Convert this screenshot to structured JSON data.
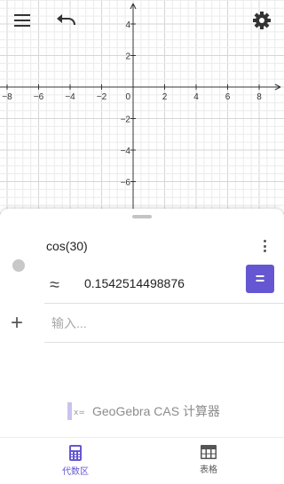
{
  "graph": {
    "x_range": [
      -9,
      9
    ],
    "y_range": [
      -7,
      7
    ],
    "x_tick_labels": [
      {
        "value": -8,
        "label": "−8"
      },
      {
        "value": -6,
        "label": "−6"
      },
      {
        "value": -4,
        "label": "−4"
      },
      {
        "value": -2,
        "label": "−2"
      },
      {
        "value": 2,
        "label": "2"
      },
      {
        "value": 4,
        "label": "4"
      },
      {
        "value": 6,
        "label": "6"
      },
      {
        "value": 8,
        "label": "8"
      }
    ],
    "y_tick_labels": [
      {
        "value": 4,
        "label": "4"
      },
      {
        "value": 2,
        "label": "2"
      },
      {
        "value": -2,
        "label": "−2"
      },
      {
        "value": -4,
        "label": "−4"
      },
      {
        "value": -6,
        "label": "−6"
      }
    ],
    "origin_label": "0",
    "grid": true
  },
  "toolbar": {
    "menu_icon": "menu-icon",
    "undo_icon": "undo-icon",
    "settings_icon": "gear-icon"
  },
  "algebra": {
    "expression": "cos(30)",
    "approx_symbol": "≈",
    "result": "0.1542514498876",
    "equals_button": "=",
    "add_symbol": "+",
    "input_placeholder": "输入...",
    "input_value": ""
  },
  "brand": {
    "text": "GeoGebra CAS 计算器",
    "icon_text": "x="
  },
  "colors": {
    "accent": "#6557d2",
    "grid_minor": "#ececec",
    "grid_major": "#d6d6d6",
    "axis": "#333333",
    "nav_inactive": "#555555"
  },
  "bottom_nav": [
    {
      "label": "代数区",
      "icon": "calculator-icon",
      "active": true
    },
    {
      "label": "表格",
      "icon": "table-icon",
      "active": false
    }
  ]
}
